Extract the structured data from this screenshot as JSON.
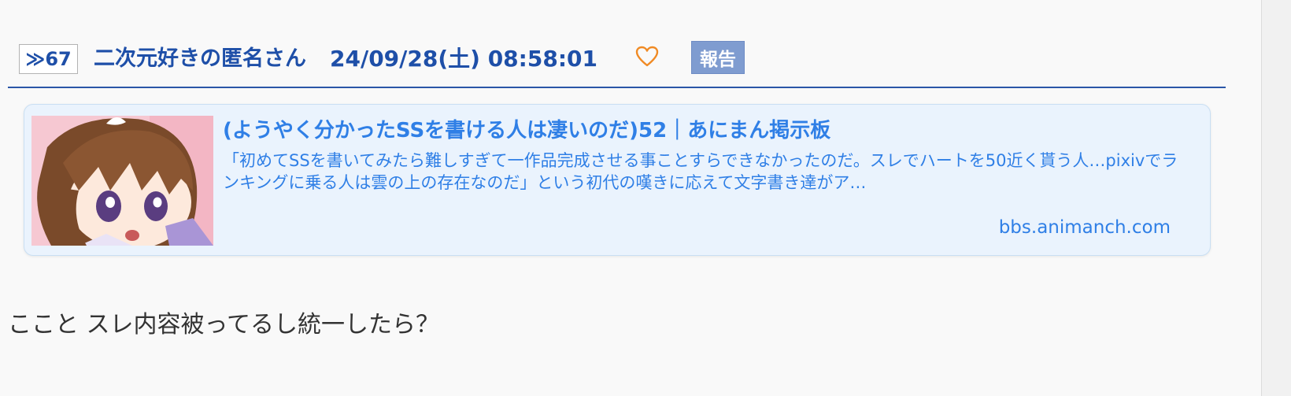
{
  "post": {
    "number": "≫67",
    "author": "二次元好きの匿名さん",
    "date": "24/09/28(土) 08:58:01",
    "report_label": "報告",
    "body": "ここと スレ内容被ってるし統一したら？"
  },
  "link_card": {
    "title": "(ようやく分かったSSを書ける人は凄いのだ)52｜あにまん掲示板",
    "description": "「初めてSSを書いてみたら難しすぎて一作品完成させる事ことすらできなかったのだ。スレでハートを50近く貰う人…pixivでランキングに乗る人は雲の上の存在なのだ」という初代の嘆きに応えて文字書き達がア…",
    "domain": "bbs.animanch.com"
  },
  "colors": {
    "accent": "#1e4fa8",
    "link": "#2f7fe6",
    "card_bg": "#eaf3fd",
    "heart": "#f08a24",
    "report_bg": "#7f9cd0"
  }
}
